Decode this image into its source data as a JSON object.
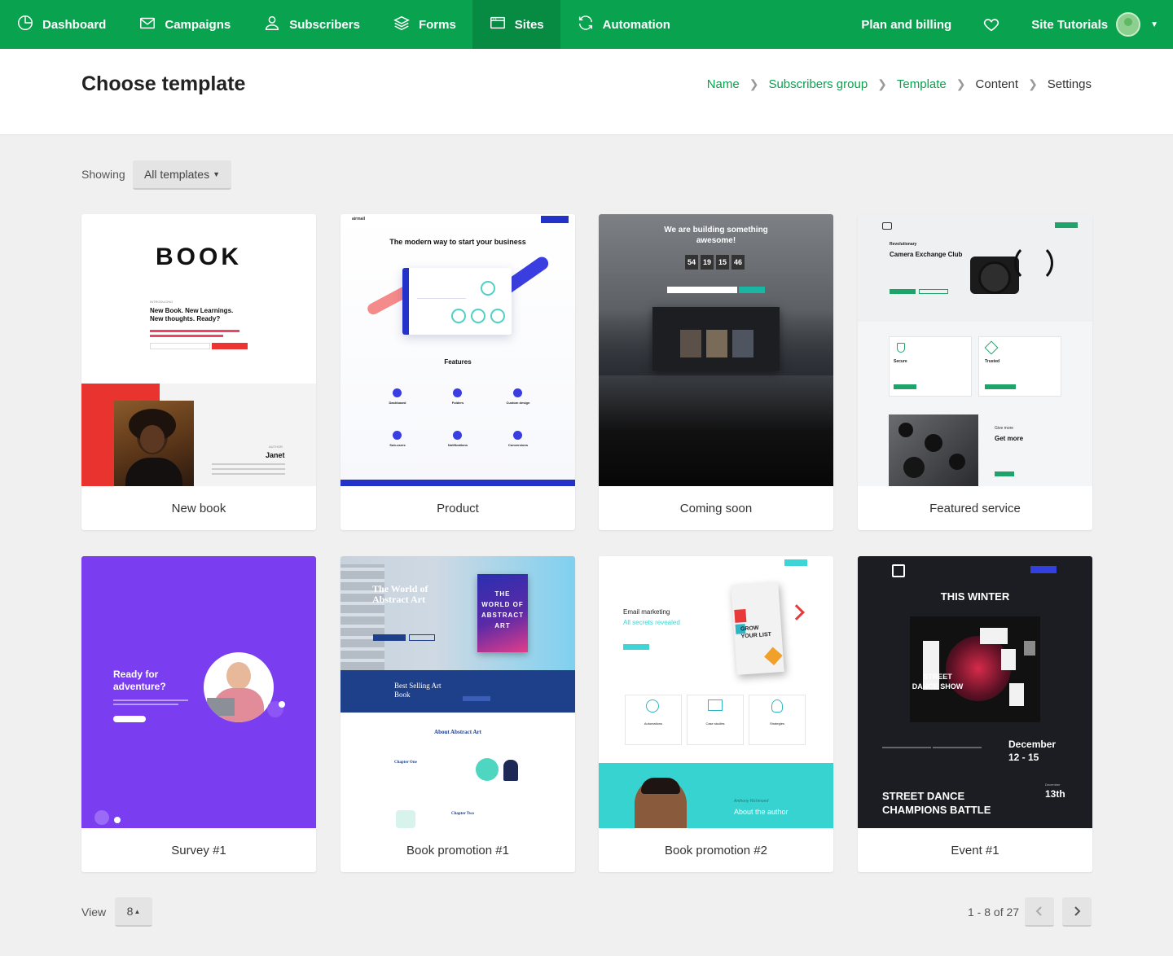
{
  "nav": {
    "items": [
      {
        "label": "Dashboard",
        "icon": "clock-pie-icon"
      },
      {
        "label": "Campaigns",
        "icon": "envelope-icon"
      },
      {
        "label": "Subscribers",
        "icon": "user-icon"
      },
      {
        "label": "Forms",
        "icon": "layers-icon"
      },
      {
        "label": "Sites",
        "icon": "browser-window-icon"
      },
      {
        "label": "Automation",
        "icon": "refresh-icon"
      }
    ],
    "active": "Sites",
    "plan_billing": "Plan and billing",
    "account": "Site Tutorials",
    "accent_color": "#09a24e"
  },
  "header": {
    "title": "Choose template",
    "breadcrumb": [
      "Name",
      "Subscribers group",
      "Template",
      "Content",
      "Settings"
    ]
  },
  "filter": {
    "label": "Showing",
    "value": "All templates"
  },
  "templates": [
    {
      "name": "New book",
      "preview": {
        "logo": "BOOK",
        "kicker": "INTRODUCING",
        "headline": "New Book. New Learnings. New thoughts. Ready?",
        "author_kicker": "AUTHOR",
        "author": "Janet"
      }
    },
    {
      "name": "Product",
      "preview": {
        "brand": "airmail",
        "headline": "The modern way to start your business",
        "section": "Features",
        "features": [
          "Dashboard",
          "Folders",
          "Custom design",
          "Sub-users",
          "Notifications",
          "Conversions"
        ]
      }
    },
    {
      "name": "Coming soon",
      "preview": {
        "headline": "We are building something awesome!",
        "countdown": [
          "54",
          "19",
          "15",
          "46"
        ]
      }
    },
    {
      "name": "Featured service",
      "preview": {
        "kicker": "Revolutionary",
        "headline": "Camera Exchange Club",
        "features": [
          "Secure",
          "Trusted"
        ],
        "sub_kicker": "Give more",
        "sub_headline": "Get more"
      }
    },
    {
      "name": "Survey #1",
      "preview": {
        "headline": "Ready for adventure?"
      }
    },
    {
      "name": "Book promotion #1",
      "preview": {
        "headline": "The World of Abstract Art",
        "book_title": "THE WORLD OF ABSTRACT ART",
        "band": "Best Selling Art Book",
        "section": "About Abstract Art",
        "chapters": [
          "Chapter One",
          "Chapter Two"
        ]
      }
    },
    {
      "name": "Book promotion #2",
      "preview": {
        "kicker": "Email marketing",
        "headline": "All secrets revealed",
        "book_title": "GROW YOUR LIST",
        "features": [
          "Automations",
          "Case studies",
          "Strategies"
        ],
        "author_name": "Anthony Richmond",
        "author_heading": "About the author"
      }
    },
    {
      "name": "Event #1",
      "preview": {
        "headline": "THIS WINTER",
        "poster": "STREET DANCE SHOW",
        "dates_title": "December",
        "dates": "12 - 15",
        "event": "STREET DANCE CHAMPIONS BATTLE",
        "event_month": "December",
        "event_day": "13th"
      }
    }
  ],
  "pagination": {
    "view_label": "View",
    "per_page": "8",
    "range": "1 - 8 of 27"
  }
}
